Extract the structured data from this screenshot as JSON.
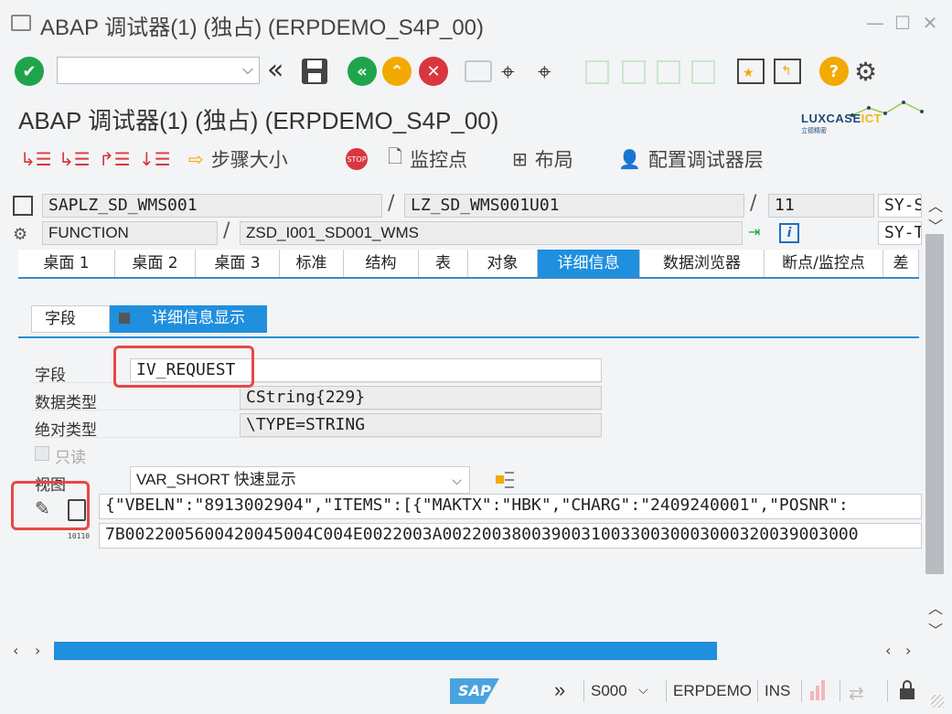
{
  "window": {
    "title": "ABAP 调试器(1)  (独占) (ERPDEMO_S4P_00)",
    "min": "—",
    "max": "☐",
    "close": "✕"
  },
  "toolbar": {
    "command_value": ""
  },
  "app_title": "ABAP 调试器(1)  (独占) (ERPDEMO_S4P_00)",
  "logo": {
    "brand": "LUXCASE",
    "brand_accent": "ICT",
    "sub": "立德精密"
  },
  "app_toolbar": {
    "step_size": "步骤大小",
    "watchpoint": "监控点",
    "layout": "布局",
    "config_layer": "配置调试器层"
  },
  "header": {
    "program": "SAPLZ_SD_WMS001",
    "include": "LZ_SD_WMS001U01",
    "line": "11",
    "sy1": "SY-S",
    "type": "FUNCTION",
    "function": "ZSD_I001_SD001_WMS",
    "sy2": "SY-T"
  },
  "tabs": [
    {
      "label": "桌面 1"
    },
    {
      "label": "桌面 2"
    },
    {
      "label": "桌面 3"
    },
    {
      "label": "标准"
    },
    {
      "label": "结构"
    },
    {
      "label": "表"
    },
    {
      "label": "对象"
    },
    {
      "label": "详细信息"
    },
    {
      "label": "数据浏览器"
    },
    {
      "label": "断点/监控点"
    },
    {
      "label": "差"
    }
  ],
  "subtabs": {
    "field": "字段",
    "detail": "详细信息显示"
  },
  "detail": {
    "field_label": "字段",
    "field_value": "IV_REQUEST",
    "datatype_label": "数据类型",
    "datatype_value": "CString{229}",
    "abstype_label": "绝对类型",
    "abstype_value": "\\TYPE=STRING",
    "readonly_label": "只读",
    "view_label": "视图",
    "view_value": "VAR_SHORT 快速显示",
    "value_text": "{\"VBELN\":\"8913002904\",\"ITEMS\":[{\"MAKTX\":\"HBK\",\"CHARG\":\"2409240001\",\"POSNR\":",
    "value_hex": "7B0022005600420045004C004E0022003A002200380039003100330030003000320039003000",
    "hex_icon_text": "10110"
  },
  "status": {
    "system": "S000",
    "client": "ERPDEMO",
    "mode": "INS",
    "sap": "SAP"
  },
  "colors": {
    "accent": "#1f8fde",
    "annotation": "#e84747",
    "ok_green": "#1ea54c",
    "warning_yellow": "#f2a900",
    "cancel_red": "#d9363e"
  }
}
